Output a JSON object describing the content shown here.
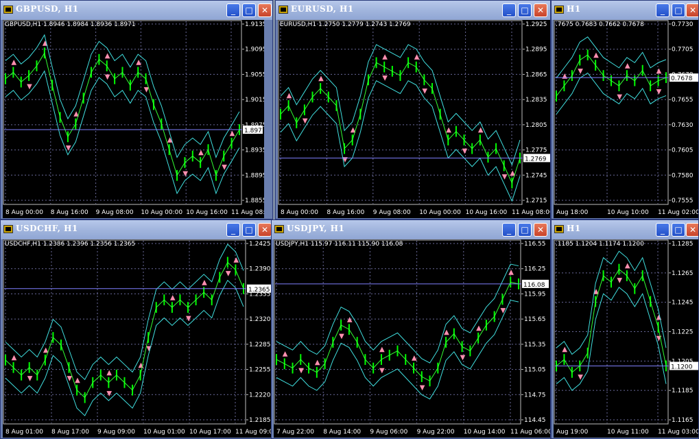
{
  "windows": [
    {
      "id": "gbpusd",
      "title": "GBPUSD, H1",
      "symbol": "GBPUSD,H1",
      "ohlc": "1.8946 1.8984 1.8936 1.8971",
      "price_labels": [
        "1.9135",
        "1.9095",
        "1.9055",
        "1.9015",
        "1.8975",
        "1.8935",
        "1.8895",
        "1.8855"
      ],
      "current": "1.8971",
      "time_labels": [
        "8 Aug 00:00",
        "8 Aug 16:00",
        "9 Aug 08:00",
        "10 Aug 00:00",
        "10 Aug 16:00",
        "11 Aug 08:00"
      ],
      "chart_data": {
        "type": "line",
        "ylim": [
          1.8855,
          1.9135
        ],
        "values": [
          1.905,
          1.906,
          1.9045,
          1.9055,
          1.907,
          1.909,
          1.904,
          1.899,
          1.896,
          1.898,
          1.902,
          1.906,
          1.908,
          1.907,
          1.905,
          1.906,
          1.904,
          1.906,
          1.905,
          1.901,
          1.898,
          1.894,
          1.89,
          1.892,
          1.893,
          1.892,
          1.894,
          1.89,
          1.893,
          1.895,
          1.8971
        ],
        "current": 1.8971
      }
    },
    {
      "id": "eurusd",
      "title": "EURUSD, H1",
      "symbol": "EURUSD,H1",
      "ohlc": "1.2750 1.2779 1.2743 1.2769",
      "price_labels": [
        "1.2925",
        "1.2895",
        "1.2865",
        "1.2835",
        "1.2805",
        "1.2775",
        "1.2745",
        "1.2715"
      ],
      "current": "1.2769",
      "time_labels": [
        "8 Aug 00:00",
        "8 Aug 16:00",
        "9 Aug 08:00",
        "10 Aug 00:00",
        "10 Aug 16:00",
        "11 Aug 08:00"
      ],
      "chart_data": {
        "type": "line",
        "ylim": [
          1.2715,
          1.2925
        ],
        "values": [
          1.282,
          1.283,
          1.281,
          1.2825,
          1.284,
          1.285,
          1.284,
          1.283,
          1.278,
          1.279,
          1.282,
          1.286,
          1.288,
          1.2875,
          1.287,
          1.2865,
          1.288,
          1.2875,
          1.286,
          1.285,
          1.282,
          1.279,
          1.28,
          1.279,
          1.278,
          1.279,
          1.277,
          1.278,
          1.276,
          1.274,
          1.2769
        ],
        "current": 1.2769
      }
    },
    {
      "id": "audusd",
      "title": "H1",
      "symbol": "",
      "ohlc": ".7675 0.7683 0.7662 0.7678",
      "price_labels": [
        "0.7730",
        "0.7705",
        "0.7678",
        "0.7655",
        "0.7630",
        "0.7605",
        "0.7580",
        "0.7555"
      ],
      "current": "0.7678",
      "time_labels": [
        "Aug 18:00",
        "10 Aug 10:00",
        "11 Aug 02:00"
      ],
      "chart_data": {
        "type": "line",
        "ylim": [
          0.7555,
          0.773
        ],
        "values": [
          0.766,
          0.767,
          0.768,
          0.7695,
          0.77,
          0.769,
          0.768,
          0.7675,
          0.767,
          0.768,
          0.7675,
          0.7685,
          0.767,
          0.7675,
          0.7678
        ],
        "current": 0.7678
      }
    },
    {
      "id": "usdchf",
      "title": "USDCHF, H1",
      "symbol": "USDCHF,H1",
      "ohlc": "1.2386 1.2396 1.2356 1.2365",
      "price_labels": [
        "1.2425",
        "1.2390",
        "1.2355",
        "1.2320",
        "1.2285",
        "1.2255",
        "1.2220",
        "1.2185"
      ],
      "current": "1.2365",
      "time_labels": [
        "8 Aug 01:00",
        "8 Aug 17:00",
        "9 Aug 09:00",
        "10 Aug 01:00",
        "10 Aug 17:00",
        "11 Aug 09:00"
      ],
      "chart_data": {
        "type": "line",
        "ylim": [
          1.2185,
          1.2425
        ],
        "values": [
          1.227,
          1.226,
          1.225,
          1.226,
          1.225,
          1.227,
          1.23,
          1.229,
          1.226,
          1.223,
          1.222,
          1.224,
          1.225,
          1.224,
          1.225,
          1.224,
          1.223,
          1.225,
          1.23,
          1.234,
          1.235,
          1.234,
          1.235,
          1.234,
          1.235,
          1.236,
          1.235,
          1.238,
          1.24,
          1.239,
          1.2365
        ],
        "current": 1.2365
      }
    },
    {
      "id": "usdjpy",
      "title": "USDJPY, H1",
      "symbol": "USDJPY,H1",
      "ohlc": "115.97 116.11 115.90 116.08",
      "price_labels": [
        "116.55",
        "116.25",
        "115.95",
        "115.65",
        "115.35",
        "115.05",
        "114.75",
        "114.45"
      ],
      "current": "116.08",
      "time_labels": [
        "7 Aug 22:00",
        "8 Aug 14:00",
        "9 Aug 06:00",
        "9 Aug 22:00",
        "10 Aug 14:00",
        "11 Aug 06:00"
      ],
      "chart_data": {
        "type": "line",
        "ylim": [
          114.45,
          116.55
        ],
        "values": [
          115.2,
          115.15,
          115.1,
          115.2,
          115.1,
          115.05,
          115.15,
          115.4,
          115.6,
          115.55,
          115.4,
          115.2,
          115.1,
          115.2,
          115.25,
          115.3,
          115.2,
          115.1,
          115.0,
          114.95,
          115.1,
          115.4,
          115.5,
          115.35,
          115.3,
          115.45,
          115.6,
          115.7,
          115.9,
          116.1,
          116.08
        ],
        "current": 116.08
      }
    },
    {
      "id": "gbpchf",
      "title": "H1",
      "symbol": "",
      "ohlc": ".1185 1.1204 1.1174 1.1200",
      "price_labels": [
        "1.1285",
        "1.1265",
        "1.1245",
        "1.1225",
        "1.1205",
        "1.1185",
        "1.1165"
      ],
      "current": "1.1200",
      "time_labels": [
        "Aug 19:00",
        "10 Aug 11:00",
        "11 Aug 03:00"
      ],
      "chart_data": {
        "type": "line",
        "ylim": [
          1.1155,
          1.1295
        ],
        "values": [
          1.12,
          1.1205,
          1.1195,
          1.12,
          1.121,
          1.125,
          1.127,
          1.1265,
          1.1275,
          1.127,
          1.126,
          1.127,
          1.125,
          1.123,
          1.12
        ],
        "current": 1.12
      }
    }
  ]
}
